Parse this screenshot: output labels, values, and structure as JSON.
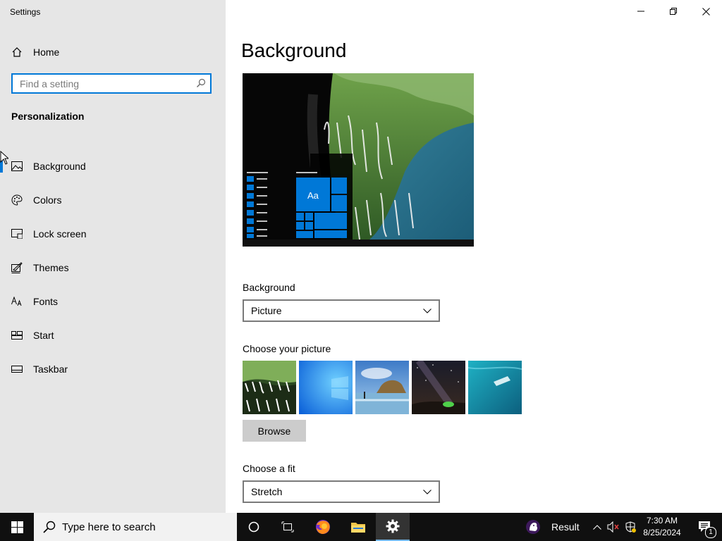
{
  "window": {
    "title": "Settings",
    "controls": [
      "minimize",
      "restore",
      "close"
    ]
  },
  "sidebar": {
    "home_label": "Home",
    "search_placeholder": "Find a setting",
    "section_title": "Personalization",
    "items": [
      {
        "label": "Background",
        "icon": "picture-icon",
        "active": true
      },
      {
        "label": "Colors",
        "icon": "palette-icon"
      },
      {
        "label": "Lock screen",
        "icon": "lock-screen-icon"
      },
      {
        "label": "Themes",
        "icon": "themes-icon"
      },
      {
        "label": "Fonts",
        "icon": "fonts-icon"
      },
      {
        "label": "Start",
        "icon": "start-icon"
      },
      {
        "label": "Taskbar",
        "icon": "taskbar-icon"
      }
    ]
  },
  "main": {
    "title": "Background",
    "preview": {
      "tile_text": "Aa"
    },
    "background_label": "Background",
    "background_value": "Picture",
    "choose_picture_label": "Choose your picture",
    "browse_label": "Browse",
    "fit_label": "Choose a fit",
    "fit_value": "Stretch"
  },
  "taskbar": {
    "search_placeholder": "Type here to search",
    "result_label": "Result",
    "time": "7:30 AM",
    "date": "8/25/2024",
    "notification_count": "1"
  },
  "colors": {
    "accent": "#0078d7",
    "sidebar_bg": "#e6e6e6",
    "taskbar_bg": "#101010"
  }
}
